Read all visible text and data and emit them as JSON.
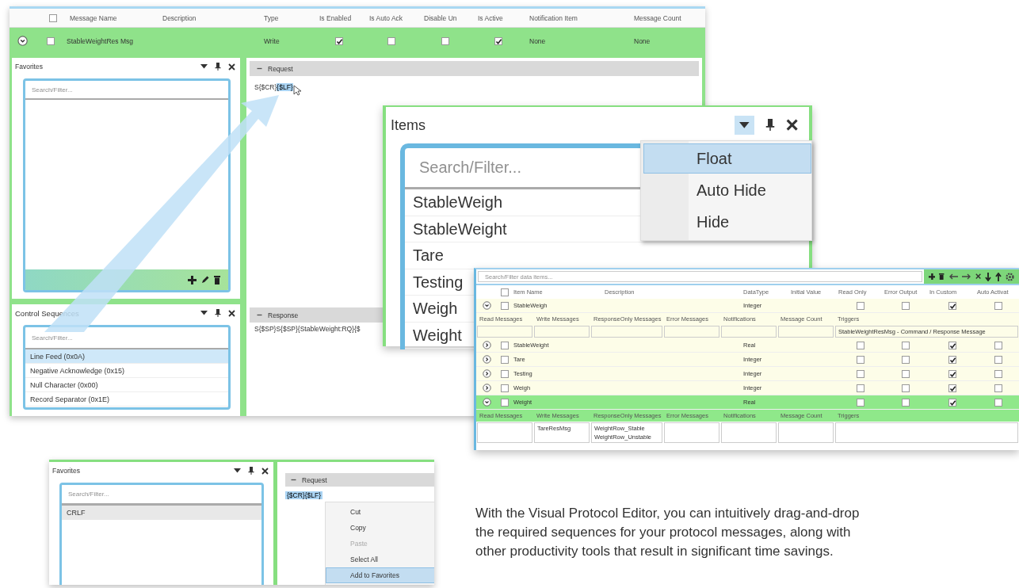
{
  "main_window": {
    "header_checked": false,
    "columns": [
      "Message Name",
      "Description",
      "Type",
      "Is Enabled",
      "Is Auto Ack",
      "Disable Un",
      "Is Active",
      "Notification Item",
      "Message Count"
    ],
    "message": {
      "name": "StableWeightRes Msg",
      "checked": false,
      "type": "Write",
      "is_enabled": true,
      "is_auto_ack": false,
      "disable_un": false,
      "is_active": true,
      "notification_item": "None",
      "message_count": "None"
    },
    "favorites": {
      "title": "Favorites",
      "search_placeholder": "Search/Filter..."
    },
    "control_sequences": {
      "title": "Control Sequences",
      "search_placeholder": "Search/Filter...",
      "items": [
        {
          "label": "Line Feed (0x0A)",
          "selected": true
        },
        {
          "label": "Negative Acknowledge (0x15)",
          "selected": false
        },
        {
          "label": "Null Character (0x00)",
          "selected": false
        },
        {
          "label": "Record Separator (0x1E)",
          "selected": false
        }
      ]
    },
    "request": {
      "title": "Request",
      "text": "S{$CR}",
      "selected_text": "{$LF}"
    },
    "response": {
      "title": "Response",
      "text": "S{$SP}S{$SP}{StableWeight:RQ}{$"
    }
  },
  "items_window": {
    "title": "Items",
    "dock_menu": [
      {
        "label": "Float",
        "selected": true
      },
      {
        "label": "Auto Hide",
        "selected": false
      },
      {
        "label": "Hide",
        "selected": false
      }
    ],
    "search_placeholder": "Search/Filter...",
    "items": [
      "StableWeigh",
      "StableWeight",
      "Tare",
      "Testing",
      "Weigh",
      "Weight"
    ]
  },
  "data_items_window": {
    "search_placeholder": "Search/Filter data items...",
    "header_checked": false,
    "columns": [
      "Item Name",
      "Description",
      "DataType",
      "Initial Value",
      "Read Only",
      "Error Output",
      "In Custom",
      "Auto Activat"
    ],
    "rows": [
      {
        "name": "StableWeigh",
        "checked": false,
        "expanded": true,
        "selected": false,
        "data_type": "Integer",
        "read_only": false,
        "error_output": false,
        "in_custom": true,
        "auto_activate": false,
        "detail_columns": [
          "Read Messages",
          "Write Messages",
          "ResponseOnly Messages",
          "Error Messages",
          "Notifications",
          "Message Count",
          "Triggers"
        ],
        "details": {
          "triggers": "StableWeightResMsg - Command / Response Message"
        }
      },
      {
        "name": "StableWeight",
        "checked": false,
        "expanded": false,
        "selected": false,
        "data_type": "Real",
        "read_only": false,
        "error_output": false,
        "in_custom": true,
        "auto_activate": false
      },
      {
        "name": "Tare",
        "checked": false,
        "expanded": false,
        "selected": false,
        "data_type": "Integer",
        "read_only": false,
        "error_output": false,
        "in_custom": true,
        "auto_activate": false
      },
      {
        "name": "Testing",
        "checked": false,
        "expanded": false,
        "selected": false,
        "data_type": "Integer",
        "read_only": false,
        "error_output": false,
        "in_custom": true,
        "auto_activate": false
      },
      {
        "name": "Weigh",
        "checked": false,
        "expanded": false,
        "selected": false,
        "data_type": "Integer",
        "read_only": false,
        "error_output": false,
        "in_custom": true,
        "auto_activate": false
      },
      {
        "name": "Weight",
        "checked": false,
        "expanded": true,
        "selected": true,
        "data_type": "Real",
        "read_only": false,
        "error_output": false,
        "in_custom": true,
        "auto_activate": false,
        "detail_columns": [
          "Read Messages",
          "Write Messages",
          "ResponseOnly Messages",
          "Error Messages",
          "Notifications",
          "Message Count",
          "Triggers"
        ],
        "details": {
          "write_messages": "TareResMsg",
          "response_messages": [
            "WeightRow_Stable",
            "WeightRow_Unstable"
          ]
        }
      }
    ]
  },
  "bottom_window": {
    "favorites": {
      "title": "Favorites",
      "search_placeholder": "Search/Filter...",
      "items": [
        {
          "label": "CRLF",
          "selected": true
        }
      ]
    },
    "request": {
      "title": "Request",
      "selected_text": "{$CR}{$LF}"
    },
    "context_menu": [
      {
        "label": "Cut",
        "disabled": false,
        "selected": false
      },
      {
        "label": "Copy",
        "disabled": false,
        "selected": false
      },
      {
        "label": "Paste",
        "disabled": true,
        "selected": false
      },
      {
        "label": "Select All",
        "disabled": false,
        "selected": false
      },
      {
        "label": "Add to Favorites",
        "disabled": false,
        "selected": true
      }
    ]
  },
  "caption": {
    "text": "With the Visual Protocol Editor, you can intuitively drag-and-drop the required sequences for your protocol messages, along with other productivity tools that result in significant time savings."
  }
}
